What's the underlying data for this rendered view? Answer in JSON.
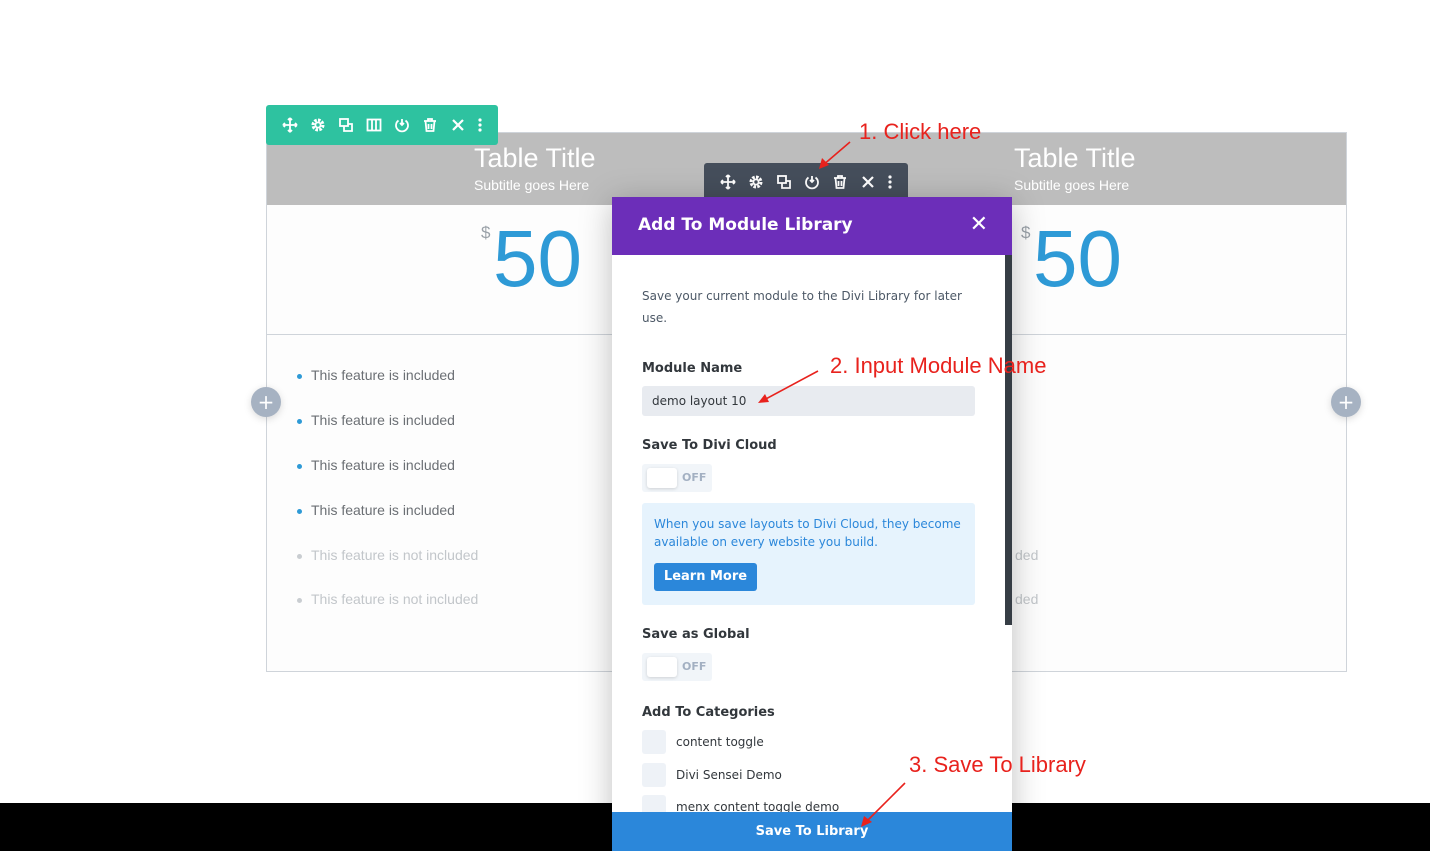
{
  "pricing": {
    "columns": [
      {
        "title": "Table Title",
        "subtitle": "Subtitle goes Here",
        "currency": "$",
        "price": "50"
      },
      {
        "title": "Table Title",
        "subtitle": "Subtitle goes Here",
        "currency": "$",
        "price": "50"
      }
    ],
    "features": [
      {
        "text": "This feature is included",
        "included": true
      },
      {
        "text": "This feature is included",
        "included": true
      },
      {
        "text": "This feature is included",
        "included": true
      },
      {
        "text": "This feature is included",
        "included": true
      },
      {
        "text": "This feature is not included",
        "included": false
      },
      {
        "text": "This feature is not included",
        "included": false
      }
    ],
    "right_feature_fragments": [
      "ded",
      "ded"
    ]
  },
  "add_row_icon": "+",
  "annotations": {
    "step1": "1. Click here",
    "step2": "2. Input Module Name",
    "step3": "3. Save To Library"
  },
  "modal": {
    "title": "Add To Module Library",
    "close_glyph": "✕",
    "description": "Save your current module to the Divi Library for later use.",
    "module_name_label": "Module Name",
    "module_name_value": "demo layout 10",
    "cloud_label": "Save To Divi Cloud",
    "cloud_toggle": "OFF",
    "cloud_info": "When you save layouts to Divi Cloud, they become available on every website you build.",
    "learn_more": "Learn More",
    "global_label": "Save as Global",
    "global_toggle": "OFF",
    "categories_label": "Add To Categories",
    "categories": [
      "content toggle",
      "Divi Sensei Demo",
      "menx content toggle demo"
    ],
    "save_button": "Save To Library"
  },
  "colors": {
    "row_toolbar": "#2ec2a0",
    "module_toolbar": "#454e5b",
    "modal_header": "#6c2eb9",
    "primary": "#2b87da",
    "annotation": "#e8221d",
    "price": "#2e9ad6"
  }
}
